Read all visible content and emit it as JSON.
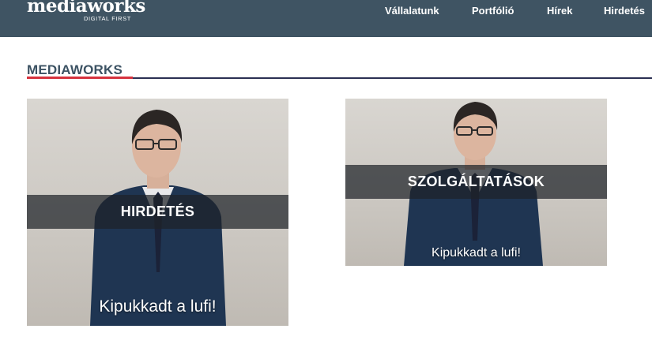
{
  "header": {
    "logo_word": "mediaworks",
    "logo_sub": "DIGITAL FIRST",
    "nav": [
      "Vállalatunk",
      "Portfólió",
      "Hírek",
      "Hirdetés"
    ]
  },
  "section": {
    "title": "MEDIAWORKS"
  },
  "cards": [
    {
      "label": "HIRDETÉS",
      "caption": "Kipukkadt a lufi!"
    },
    {
      "label": "SZOLGÁLTATÁSOK",
      "caption": "Kipukkadt a lufi!"
    }
  ],
  "colors": {
    "header_bg": "#3f5463",
    "title": "#3c5263",
    "accent_red": "#d6323e",
    "rule_dark": "#2a2f52"
  }
}
